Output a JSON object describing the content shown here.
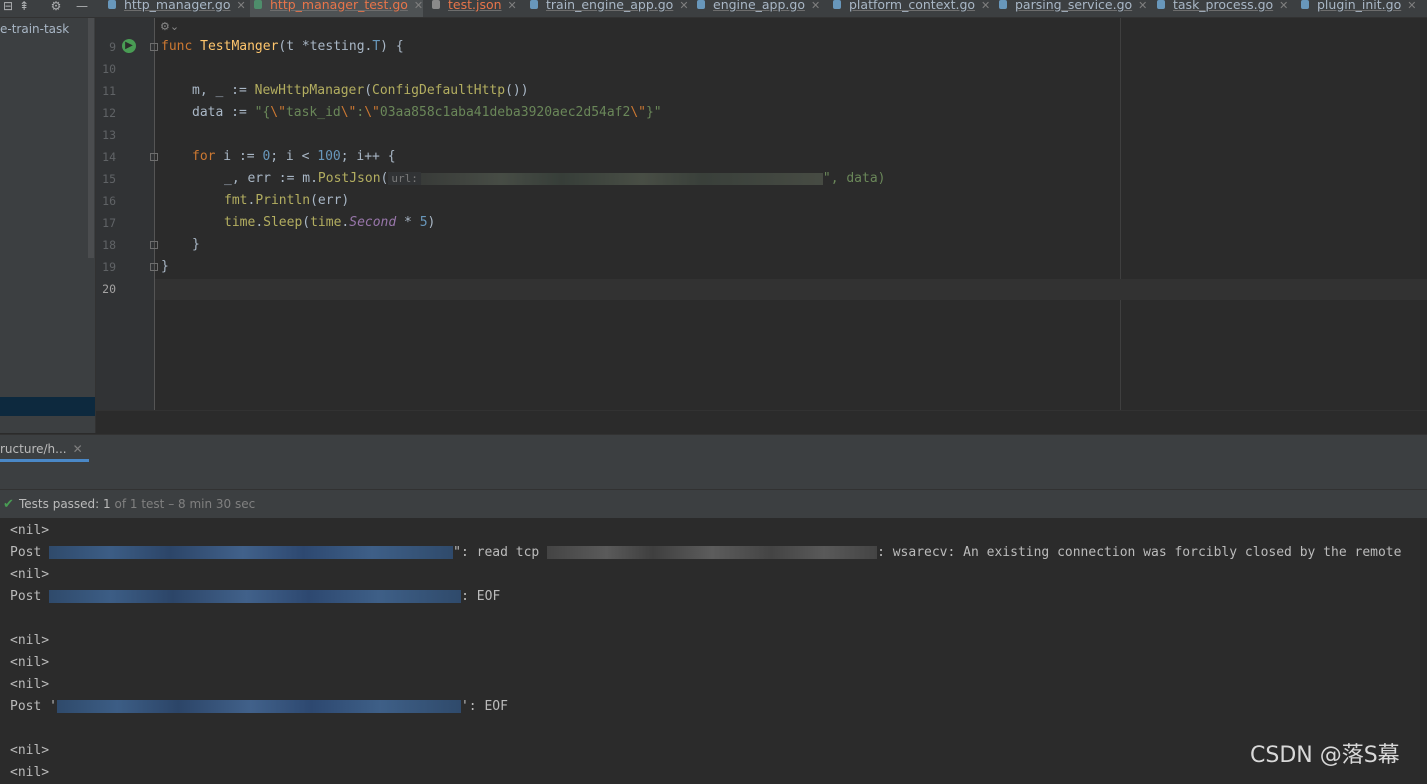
{
  "toolbar": {
    "icons": [
      "layout-icon",
      "settings-icon",
      "minimize-icon"
    ]
  },
  "tabs": [
    {
      "label": "http_manager.go",
      "kind": "go",
      "state": "normal"
    },
    {
      "label": "http_manager_test.go",
      "kind": "test",
      "state": "active"
    },
    {
      "label": "test.json",
      "kind": "json",
      "state": "modified"
    },
    {
      "label": "train_engine_app.go",
      "kind": "go",
      "state": "normal"
    },
    {
      "label": "engine_app.go",
      "kind": "go",
      "state": "normal"
    },
    {
      "label": "platform_context.go",
      "kind": "go",
      "state": "normal"
    },
    {
      "label": "parsing_service.go",
      "kind": "go",
      "state": "normal"
    },
    {
      "label": "task_process.go",
      "kind": "go",
      "state": "normal"
    },
    {
      "label": "plugin_init.go",
      "kind": "go",
      "state": "normal"
    }
  ],
  "project": {
    "label": "e-train-task"
  },
  "editor": {
    "line_numbers": [
      "9",
      "10",
      "11",
      "12",
      "13",
      "14",
      "15",
      "16",
      "17",
      "18",
      "19",
      "20"
    ],
    "url_hint": "url:",
    "code": {
      "l9_kw": "func",
      "l9_name": "TestManger",
      "l9_rest": "(t *testing.",
      "l9_type": "T",
      "l9_end": ") {",
      "l11_a": "m, _ := ",
      "l11_fn": "NewHttpManager",
      "l11_b": "(",
      "l11_fn2": "ConfigDefaultHttp",
      "l11_c": "())",
      "l12_a": "data := ",
      "l12_s1": "\"{",
      "l12_e1": "\\\"",
      "l12_s2": "task_id",
      "l12_e2": "\\\"",
      "l12_s3": ":",
      "l12_e3": "\\\"",
      "l12_s4": "03aa858c1aba41deba3920aec2d54af2",
      "l12_e4": "\\\"",
      "l12_s5": "}\"",
      "l14_kw": "for",
      "l14_a": " i := ",
      "l14_n1": "0",
      "l14_b": "; i < ",
      "l14_n2": "100",
      "l14_c": "; i++ {",
      "l15_a": "_, err := m.",
      "l15_fn": "PostJson",
      "l15_b": "(",
      "l15_c": "\", data)",
      "l16_pkg": "fmt",
      "l16_dot": ".",
      "l16_fn": "Println",
      "l16_b": "(err)",
      "l17_pkg": "time",
      "l17_dot": ".",
      "l17_fn": "Sleep",
      "l17_b": "(",
      "l17_pkg2": "time",
      "l17_dot2": ".",
      "l17_cst": "Second",
      "l17_c": " * ",
      "l17_n": "5",
      "l17_d": ")",
      "l18": "}",
      "l19": "}"
    }
  },
  "run_panel": {
    "tab_label": "ructure/h...",
    "status_label": "Tests passed:",
    "status_count": "1",
    "status_detail": "of 1 test – 8 min 30 sec",
    "console": {
      "nil": "<nil>",
      "post": "Post",
      "post_q": "Post '",
      "read_tcp_prefix": "\": read tcp ",
      "read_tcp_suffix": ": wsarecv: An existing connection was forcibly closed by the remote",
      "eof1": ": EOF",
      "eof2": "': EOF"
    }
  },
  "watermark": "CSDN @落S幕"
}
